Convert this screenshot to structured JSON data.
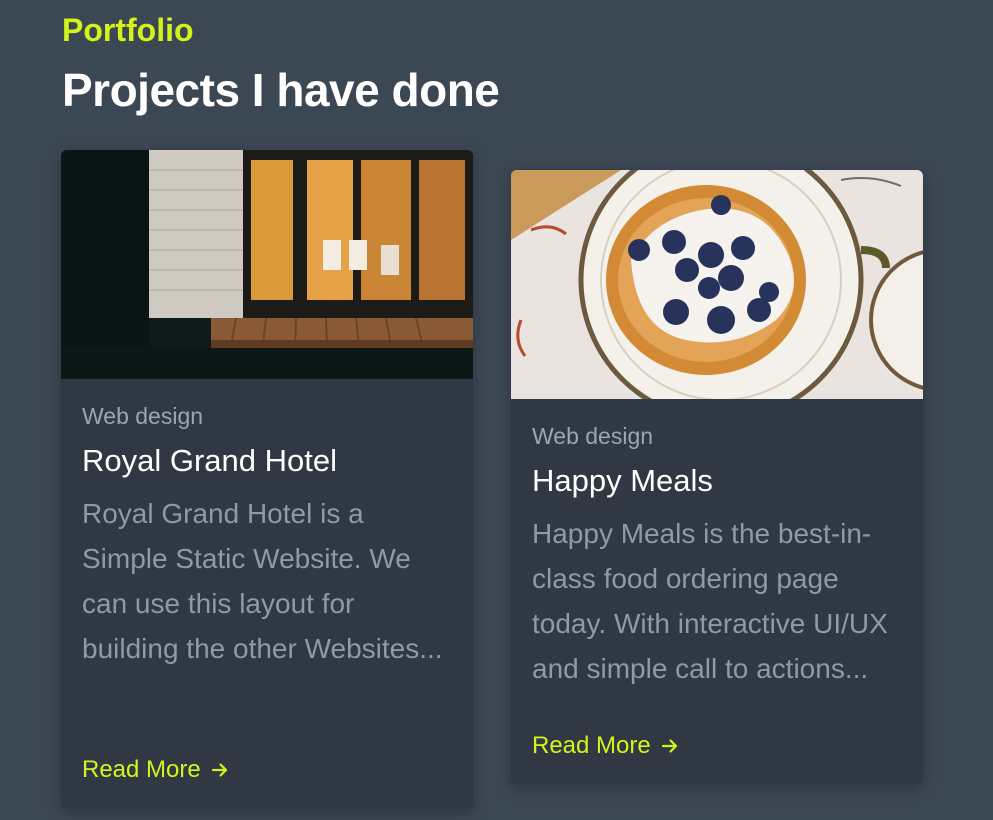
{
  "section": {
    "eyebrow": "Portfolio",
    "title": "Projects I have done"
  },
  "projects": [
    {
      "image_alt": "hotel-house-photo",
      "category": "Web design",
      "title": "Royal Grand Hotel",
      "description": "Royal Grand Hotel is a Simple Static Website. We can use this layout for building the other Websites...",
      "link_label": "Read More"
    },
    {
      "image_alt": "pancakes-photo",
      "category": "Web design",
      "title": "Happy Meals",
      "description": "Happy Meals is the best-in-class food ordering page today. With interactive UI/UX and simple call to actions...",
      "link_label": "Read More"
    }
  ],
  "colors": {
    "accent": "#d4f31c",
    "background": "#3c4754",
    "card": "#2f3843"
  }
}
